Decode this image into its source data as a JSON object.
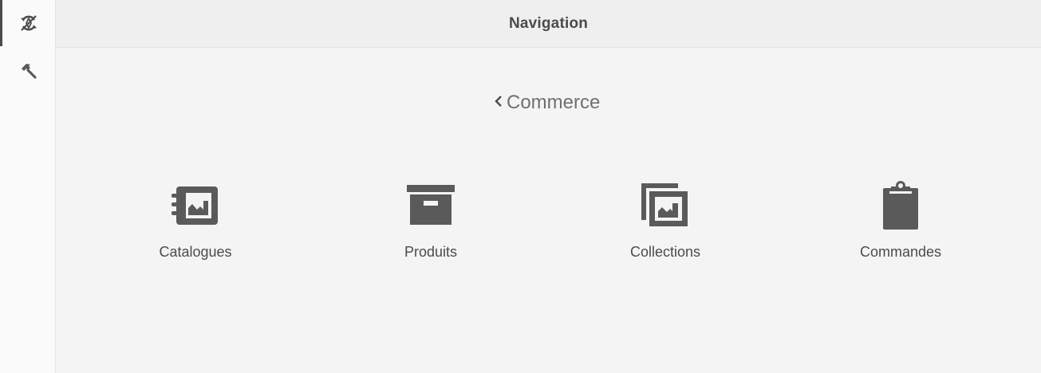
{
  "rail": {
    "items": [
      {
        "name": "navigation-icon",
        "active": true
      },
      {
        "name": "tools-icon",
        "active": false
      }
    ]
  },
  "header": {
    "title": "Navigation"
  },
  "breadcrumb": {
    "back_label": "Commerce",
    "icon": "chevron-left-icon"
  },
  "tiles": [
    {
      "label": "Catalogues",
      "icon": "catalog-icon"
    },
    {
      "label": "Produits",
      "icon": "box-icon"
    },
    {
      "label": "Collections",
      "icon": "collections-icon"
    },
    {
      "label": "Commandes",
      "icon": "clipboard-icon"
    }
  ],
  "colors": {
    "icon": "#5a5a5a",
    "text": "#4b4b4b",
    "background": "#f4f4f4",
    "rail": "#fafafa",
    "header": "#efefef"
  }
}
